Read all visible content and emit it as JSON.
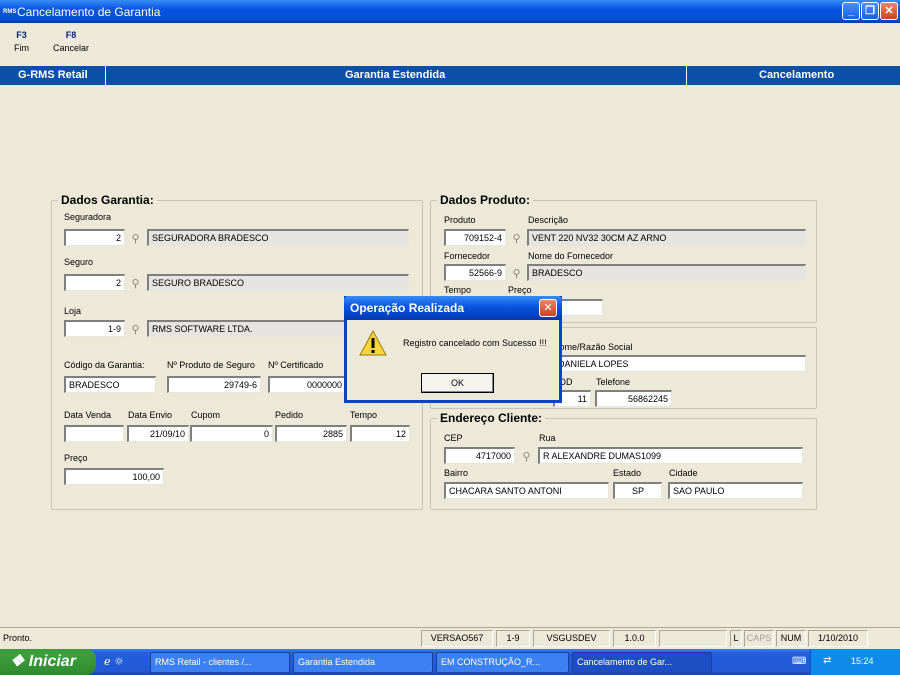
{
  "window": {
    "title": "Cancelamento de Garantia",
    "logo": "RMS",
    "buttons": [
      "minimize",
      "maximize",
      "close"
    ]
  },
  "fkeys": [
    {
      "key": "F3",
      "label": "Fim"
    },
    {
      "key": "F8",
      "label": "Cancelar"
    }
  ],
  "header": {
    "left": "G-RMS Retail",
    "center": "Garantia Estendida",
    "right": "Cancelamento"
  },
  "dados_garantia": {
    "legend": "Dados Garantia:",
    "seguradora_label": "Seguradora",
    "seguradora_code": "2",
    "seguradora_name": "SEGURADORA BRADESCO",
    "seguro_label": "Seguro",
    "seguro_code": "2",
    "seguro_name": "SEGURO BRADESCO",
    "loja_label": "Loja",
    "loja_code": "1-9",
    "loja_name": "RMS SOFTWARE LTDA.",
    "codigo_label": "Código da Garantia:",
    "codigo_value": "BRADESCO",
    "nprod_label": "Nº Produto de Seguro",
    "nprod_value": "29749-6",
    "ncert_label": "Nº Certificado",
    "ncert_value": "0000000",
    "dvenda_label": "Data Venda",
    "dvenda_value": "",
    "denvio_label": "Data Envio",
    "denvio_value": "21/09/10",
    "cupom_label": "Cupom",
    "cupom_value": "0",
    "pedido_label": "Pedido",
    "pedido_value": "2885",
    "tempo_label": "Tempo",
    "tempo_value": "12",
    "preco_label": "Preço",
    "preco_value": "100,00"
  },
  "dados_produto": {
    "legend": "Dados Produto:",
    "produto_label": "Produto",
    "produto_value": "709152-4",
    "descricao_label": "Descrição",
    "descricao_value": "VENT 220 NV32 30CM AZ ARNO",
    "fornecedor_label": "Fornecedor",
    "fornecedor_value": "52566-9",
    "nomefor_label": "Nome do Fornecedor",
    "nomefor_value": "BRADESCO",
    "tempo_label": "Tempo",
    "preco_label": "Preço"
  },
  "dados_cliente": {
    "nome_label": "Nome/Razão Social",
    "nome_value": "DANIELA LOPES",
    "ddd_label": "DDD",
    "ddd_value": "11",
    "telefone_label": "Telefone",
    "telefone_value": "56862245"
  },
  "endereco": {
    "legend": "Endereço Cliente:",
    "cep_label": "CEP",
    "cep_value": "4717000",
    "rua_label": "Rua",
    "rua_value": "R ALEXANDRE DUMAS1099",
    "bairro_label": "Bairro",
    "bairro_value": "CHACARA SANTO ANTONI",
    "estado_label": "Estado",
    "estado_value": "SP",
    "cidade_label": "Cidade",
    "cidade_value": "SAO PAULO"
  },
  "dialog": {
    "title": "Operação Realizada",
    "message": "Registro cancelado com Sucesso !!!",
    "ok": "OK",
    "icon": "warning-icon"
  },
  "status": {
    "text": "Pronto.",
    "panels": [
      "VERSAO567",
      "1-9",
      "VSGUSDEV",
      "1.0.0",
      "",
      "L",
      "CAPS",
      "NUM",
      "1/10/2010"
    ]
  },
  "taskbar": {
    "start": "Iniciar",
    "items": [
      "RMS Retail - clientes /...",
      "Garantia Estendida",
      "EM CONSTRUÇÃO_R...",
      "Cancelamento de Gar..."
    ],
    "clock": "15:24"
  }
}
